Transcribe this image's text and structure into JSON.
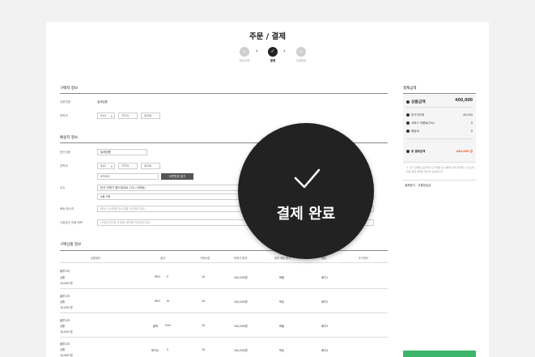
{
  "title": "주문 / 결제",
  "steps": [
    {
      "num": "01",
      "label": "바로주문"
    },
    {
      "num": "",
      "label": "결제"
    },
    {
      "num": "03",
      "label": "주문완료"
    }
  ],
  "orderer": {
    "heading": "구매자 정보",
    "name_label": "주문자명",
    "name_value": "밀레링룸",
    "phone_label": "연락처",
    "phone": [
      "010",
      "7274",
      "4226"
    ]
  },
  "shipping": {
    "heading": "배송지 정보",
    "recipient_label": "받는사람",
    "recipient_value": "밀레링룸",
    "phone_label": "연락처",
    "phone": [
      "010",
      "7374",
      "4226"
    ],
    "zip_value": "47510",
    "zip_button": "우편번호 찾기",
    "address_label": "주소",
    "address1": "부산 연제구 월드컵대로 120 (거제동)",
    "address2": "A동 2층",
    "message_label": "배송 메시지",
    "message_placeholder": "배송시 요청할 메시지를 작성해주세요.",
    "request_label": "사업승인 요청 메모",
    "request_placeholder": "사업승인요청 요청할 메모를 작성해주세요."
  },
  "products": {
    "heading": "구매상품 정보",
    "columns": [
      "상품정보",
      "옵션",
      "구매수량",
      "판매가 합계",
      "결제 배송 방식",
      "배송",
      "추가정보"
    ],
    "rows": [
      {
        "brand": "블루니아",
        "name": "상품",
        "price": "10,000 원",
        "option": "RED",
        "size": "S",
        "qty": "10",
        "total": "100,000원",
        "method": "화물",
        "delivery": "배지1"
      },
      {
        "brand": "블루니아",
        "name": "상품",
        "price": "10,000 원",
        "option": "RED",
        "size": "M",
        "qty": "10",
        "total": "100,000원",
        "method": "택송",
        "delivery": "배지2"
      },
      {
        "brand": "블루니아",
        "name": "상품",
        "price": "10,000 원",
        "option": "블랙",
        "size": "Free",
        "qty": "10",
        "total": "100,000원",
        "method": "화물",
        "delivery": "배지3"
      },
      {
        "brand": "블루니아",
        "name": "상품",
        "price": "10,000 원",
        "option": "화이트",
        "size": "S",
        "qty": "10",
        "total": "100,000원",
        "method": "택송",
        "delivery": "배지4"
      }
    ]
  },
  "summary": {
    "heading": "결제금액",
    "product_amount_label": "상품금액",
    "product_amount": "400,000",
    "vat_label": "부가가치세",
    "vat": "40,000",
    "service_label": "서비스 이용료(3%)",
    "service": "0",
    "shipping_label": "배송비",
    "shipping": "0",
    "total_label": "총 결제금액",
    "total": "440,000 원",
    "note": "※ 상기 금액은 공급자의 단가변동 등 상황에 따라 변경될 수 있으며 최종 결제 금액은 확인후 안내됩니다.",
    "pay_label": "결제방식",
    "pay_value": "무통장입금"
  },
  "overlay": {
    "message": "결제 완료"
  }
}
